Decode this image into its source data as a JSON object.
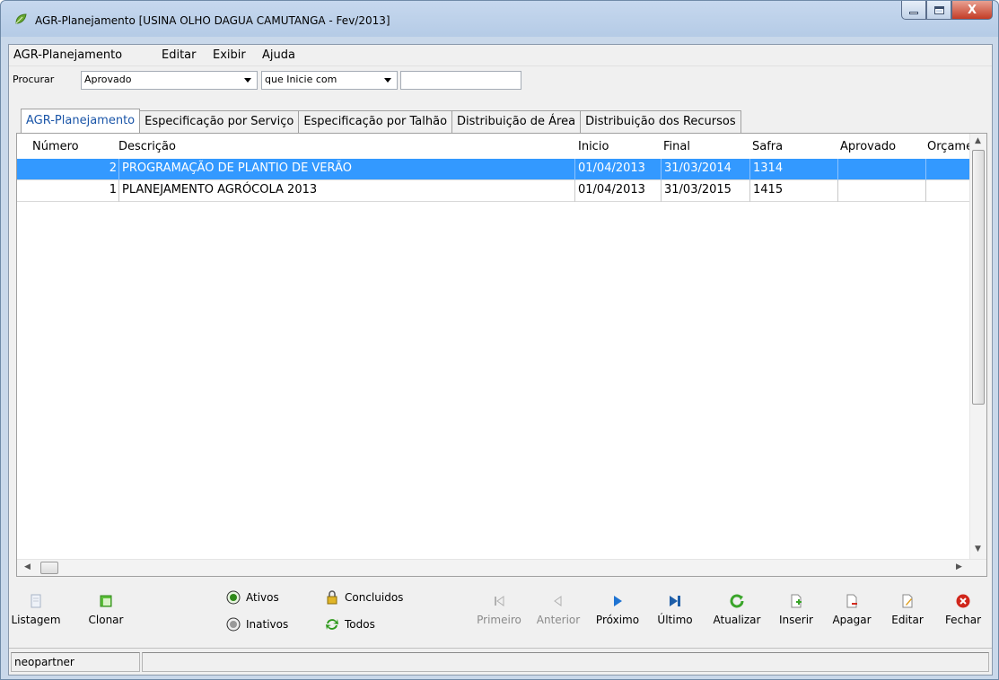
{
  "window": {
    "title": "AGR-Planejamento [USINA OLHO  DAGUA CAMUTANGA - Fev/2013]",
    "close_glyph": "X"
  },
  "menu": [
    "AGR-Planejamento",
    "Editar",
    "Exibir",
    "Ajuda"
  ],
  "search": {
    "label": "Procurar",
    "field": "Aprovado",
    "mode": "que Inicie com",
    "value": ""
  },
  "tabs": [
    "AGR-Planejamento",
    "Especificação por Serviço",
    "Especificação por Talhão",
    "Distribuição de Área",
    "Distribuição dos Recursos"
  ],
  "grid": {
    "columns": [
      "Número",
      "Descrição",
      "Inicio",
      "Final",
      "Safra",
      "Aprovado",
      "Orçame"
    ],
    "rows": [
      {
        "numero": "2",
        "descricao": "PROGRAMAÇÃO DE PLANTIO DE VERÃO",
        "inicio": "01/04/2013",
        "final": "31/03/2014",
        "safra": "1314",
        "aprovado": "",
        "orcamento": ""
      },
      {
        "numero": "1",
        "descricao": "PLANEJAMENTO AGRÓCOLA 2013",
        "inicio": "01/04/2013",
        "final": "31/03/2015",
        "safra": "1415",
        "aprovado": "",
        "orcamento": ""
      }
    ],
    "selected_row": 0
  },
  "toolbar": {
    "listagem": "Listagem",
    "clonar": "Clonar",
    "ativos": "Ativos",
    "inativos": "Inativos",
    "concluidos": "Concluidos",
    "todos": "Todos",
    "primeiro": "Primeiro",
    "anterior": "Anterior",
    "proximo": "Próximo",
    "ultimo": "Último",
    "atualizar": "Atualizar",
    "inserir": "Inserir",
    "apagar": "Apagar",
    "editar": "Editar",
    "fechar": "Fechar"
  },
  "status": {
    "user": "neopartner"
  },
  "colors": {
    "selection": "#3399ff",
    "active_tab_text": "#1a55a8",
    "close_button": "#c43c26"
  }
}
